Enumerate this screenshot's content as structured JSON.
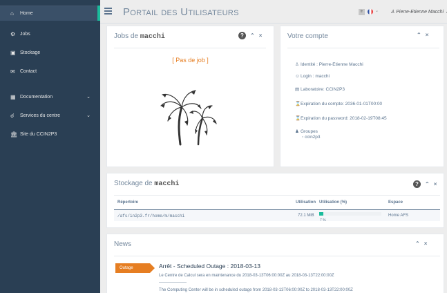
{
  "sidebar": {
    "items": [
      {
        "label": "Home",
        "icon": "home-icon"
      },
      {
        "label": "Jobs",
        "icon": "cogs-icon"
      },
      {
        "label": "Stockage",
        "icon": "hdd-icon"
      },
      {
        "label": "Contact",
        "icon": "envelope-icon"
      },
      {
        "label": "Documentation",
        "icon": "book-icon"
      },
      {
        "label": "Services du centre",
        "icon": "link-icon"
      },
      {
        "label": "Site du CCIN2P3",
        "icon": "bank-icon"
      }
    ]
  },
  "topbar": {
    "title": "Portail des Utilisateurs",
    "lang": "fr",
    "user": "Pierre-Etienne Macchi"
  },
  "jobs": {
    "title_prefix": "Jobs de",
    "user_code": "macchi",
    "empty": "[ Pas de job ]"
  },
  "account": {
    "title": "Votre compte",
    "lines": [
      "Identité : Pierre-Etienne Macchi",
      "Login : macchi",
      "Laboratoire: CCIN2P3",
      "Expiration du compte: 2036-01-01T00:00",
      "Expiration du password: 2018-02-19T08:45",
      "Groupes"
    ],
    "groups": [
      "ccin2p3"
    ]
  },
  "storage": {
    "title_prefix": "Stockage de",
    "user_code": "macchi",
    "headers": [
      "Répertoire",
      "Utilisation",
      "Utilisation (%)",
      "Espace"
    ],
    "row": {
      "path": "/afs/in2p3.fr/home/m/macchi",
      "usage": "72.1 MiB",
      "percent_label": "7 %",
      "percent": 7,
      "space": "Home AFS"
    }
  },
  "news": {
    "title": "News",
    "badge": "Outage",
    "headline": "Arrêt - Scheduled Outage : 2018-03-13",
    "line_fr": "Le Centre de Calcul sera en maintenance du 2018-03-13T06:00:00Z au 2018-03-13T22:00:00Z",
    "separator": "--------------------",
    "line_en": "The Computing Center will be in scheduled outage from 2018-03-13T06:00:00Z to 2018-03-13T22:00:00Z"
  },
  "colors": {
    "sidebar": "#2a3f54",
    "accent": "#1abb9c",
    "outage": "#e67e22"
  }
}
